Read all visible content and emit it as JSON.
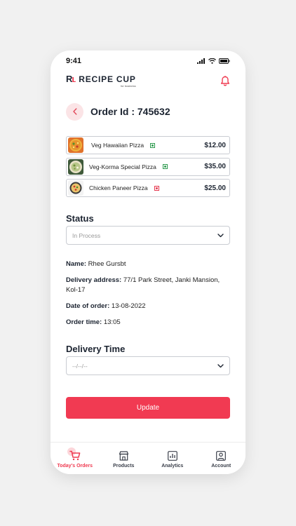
{
  "status_bar": {
    "time": "9:41"
  },
  "header": {
    "brand_mark": "R",
    "brand_name": "RECIPE CUP",
    "brand_sub": "for business"
  },
  "order": {
    "title": "Order Id : 745632"
  },
  "items": [
    {
      "name": "Veg Hawaiian Pizza",
      "price": "$12.00",
      "diet": "veg",
      "diet_color": "#2e9b4f"
    },
    {
      "name": "Veg-Korma Special Pizza",
      "price": "$35.00",
      "diet": "veg",
      "diet_color": "#2e9b4f"
    },
    {
      "name": "Chicken Paneer Pizza",
      "price": "$25.00",
      "diet": "non-veg",
      "diet_color": "#e53950"
    }
  ],
  "status": {
    "label": "Status",
    "value": "In Process"
  },
  "details": {
    "name_label": "Name:",
    "name_value": " Rhee Gursbt",
    "address_label": "Delivery address:",
    "address_value": " 77/1 Park Street, Janki Mansion, Kol-17",
    "date_label": "Date of order:",
    "date_value": " 13-08-2022",
    "time_label": "Order time:",
    "time_value": " 13:05"
  },
  "delivery_time": {
    "label": "Delivery Time",
    "value": "--/--/--"
  },
  "update_button": "Update",
  "nav": [
    {
      "label": "Today's Orders",
      "icon": "cart-icon",
      "active": true
    },
    {
      "label": "Products",
      "icon": "store-icon",
      "active": false
    },
    {
      "label": "Analytics",
      "icon": "analytics-icon",
      "active": false
    },
    {
      "label": "Account",
      "icon": "account-icon",
      "active": false
    }
  ],
  "colors": {
    "accent": "#f13a52",
    "text": "#1c2431",
    "veg": "#2e9b4f",
    "non_veg": "#e53950"
  }
}
